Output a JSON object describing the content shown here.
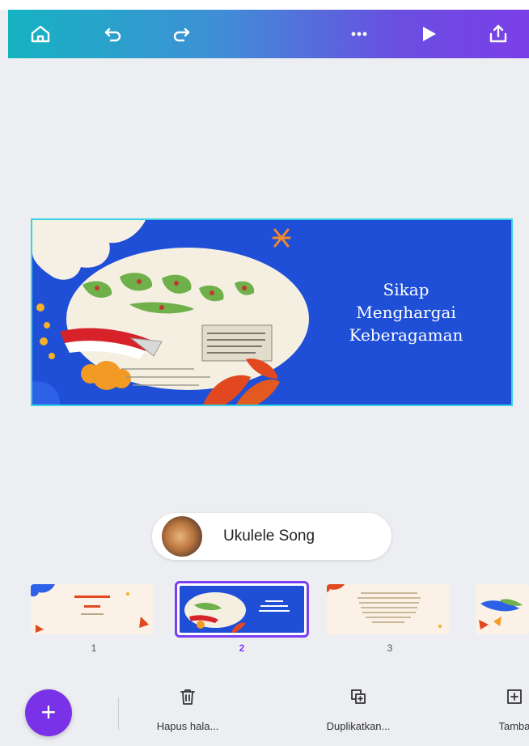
{
  "slide": {
    "title_lines": [
      "Sikap",
      "Menghargai",
      "Keberagaman"
    ]
  },
  "music": {
    "title": "Ukulele Song"
  },
  "thumbnails": [
    {
      "number": "1"
    },
    {
      "number": "2",
      "selected": true
    },
    {
      "number": "3"
    }
  ],
  "actions": {
    "add_icon": "+",
    "delete_label": "Hapus hala...",
    "duplicate_label": "Duplikatkan...",
    "add_page_label": "Tamba"
  },
  "colors": {
    "slide_background": "#1f4fd6",
    "accent": "#7a32e8",
    "selection": "#7a3ff0"
  },
  "icons": {
    "toolbar": [
      "home-icon",
      "undo-icon",
      "redo-icon",
      "more-icon",
      "play-icon",
      "share-icon"
    ],
    "actions": [
      "trash-icon",
      "duplicate-icon",
      "add-page-icon"
    ]
  }
}
